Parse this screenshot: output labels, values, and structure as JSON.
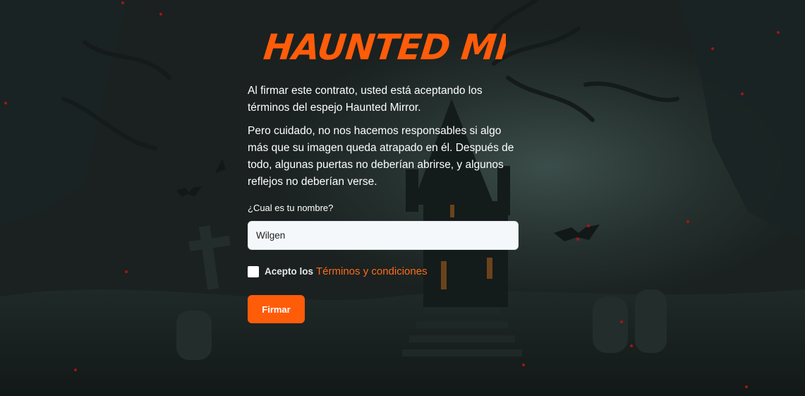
{
  "app": {
    "logo_text": "HAUNTED MIRROR",
    "accent_color": "#ff5c0a"
  },
  "contract": {
    "paragraph_1": "Al firmar este contrato, usted está aceptando los términos del espejo Haunted Mirror.",
    "paragraph_2": "Pero cuidado, no nos hacemos responsables si algo más que su imagen queda atrapado en él. Después de todo, algunas puertas no deberían abrirse, y algunos reflejos no deberían verse."
  },
  "form": {
    "name_label": "¿Cual es tu nombre?",
    "name_value": "Wilgen",
    "accept_prefix": "Acepto los",
    "terms_link": "Términos y condiciones",
    "terms_checked": false,
    "submit_label": "Firmar"
  }
}
